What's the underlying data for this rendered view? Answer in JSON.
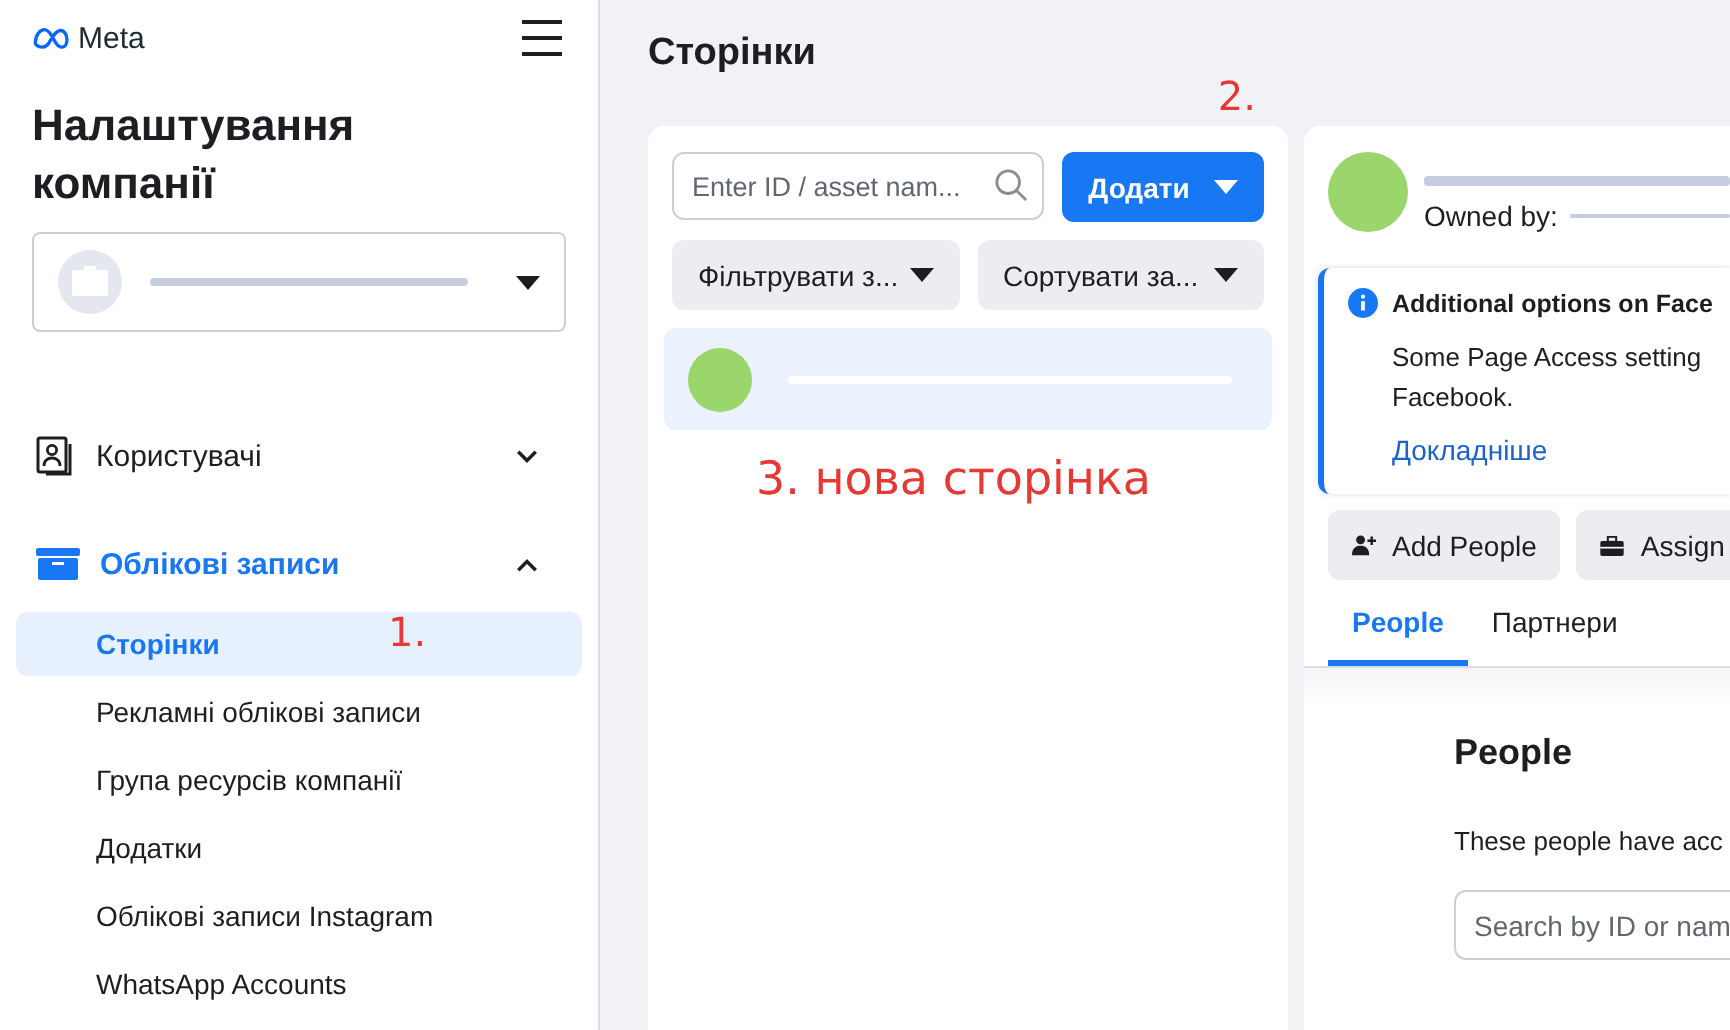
{
  "header": {
    "logo": "Meta"
  },
  "sidebar": {
    "title": "Налаштування компанії",
    "sections": [
      {
        "kind": "users",
        "label": "Користувачі",
        "expanded": false
      },
      {
        "kind": "accounts",
        "label": "Облікові записи",
        "expanded": true,
        "children": [
          {
            "label": "Сторінки",
            "selected": true,
            "annotation": "1."
          },
          {
            "label": "Рекламні облікові записи",
            "selected": false
          },
          {
            "label": "Група ресурсів компанії",
            "selected": false
          },
          {
            "label": "Додатки",
            "selected": false
          },
          {
            "label": "Облікові записи Instagram",
            "selected": false
          },
          {
            "label": "WhatsApp Accounts",
            "selected": false
          }
        ]
      }
    ]
  },
  "main": {
    "title": "Сторінки",
    "search": {
      "placeholder": "Enter ID / asset nam..."
    },
    "add_button": {
      "label": "Додати",
      "annotation": "2."
    },
    "filter": "Фільтрувати з...",
    "sort": "Сортувати за...",
    "assets": [
      {
        "selected": true
      }
    ],
    "annotation": "3. нова сторінка"
  },
  "detail": {
    "owner_label": "Owned by:",
    "notice": {
      "title": "Additional options on Face",
      "body": "Some Page Access setting\nFacebook.",
      "link": "Докладніше"
    },
    "buttons": [
      {
        "kind": "add-person",
        "label": "Add People"
      },
      {
        "kind": "briefcase",
        "label": "Assign"
      }
    ],
    "tabs": [
      {
        "label": "People",
        "selected": true
      },
      {
        "label": "Партнери",
        "selected": false
      }
    ],
    "heading": "People",
    "description": "These people have acc",
    "search": {
      "placeholder": "Search by ID or nam"
    }
  }
}
